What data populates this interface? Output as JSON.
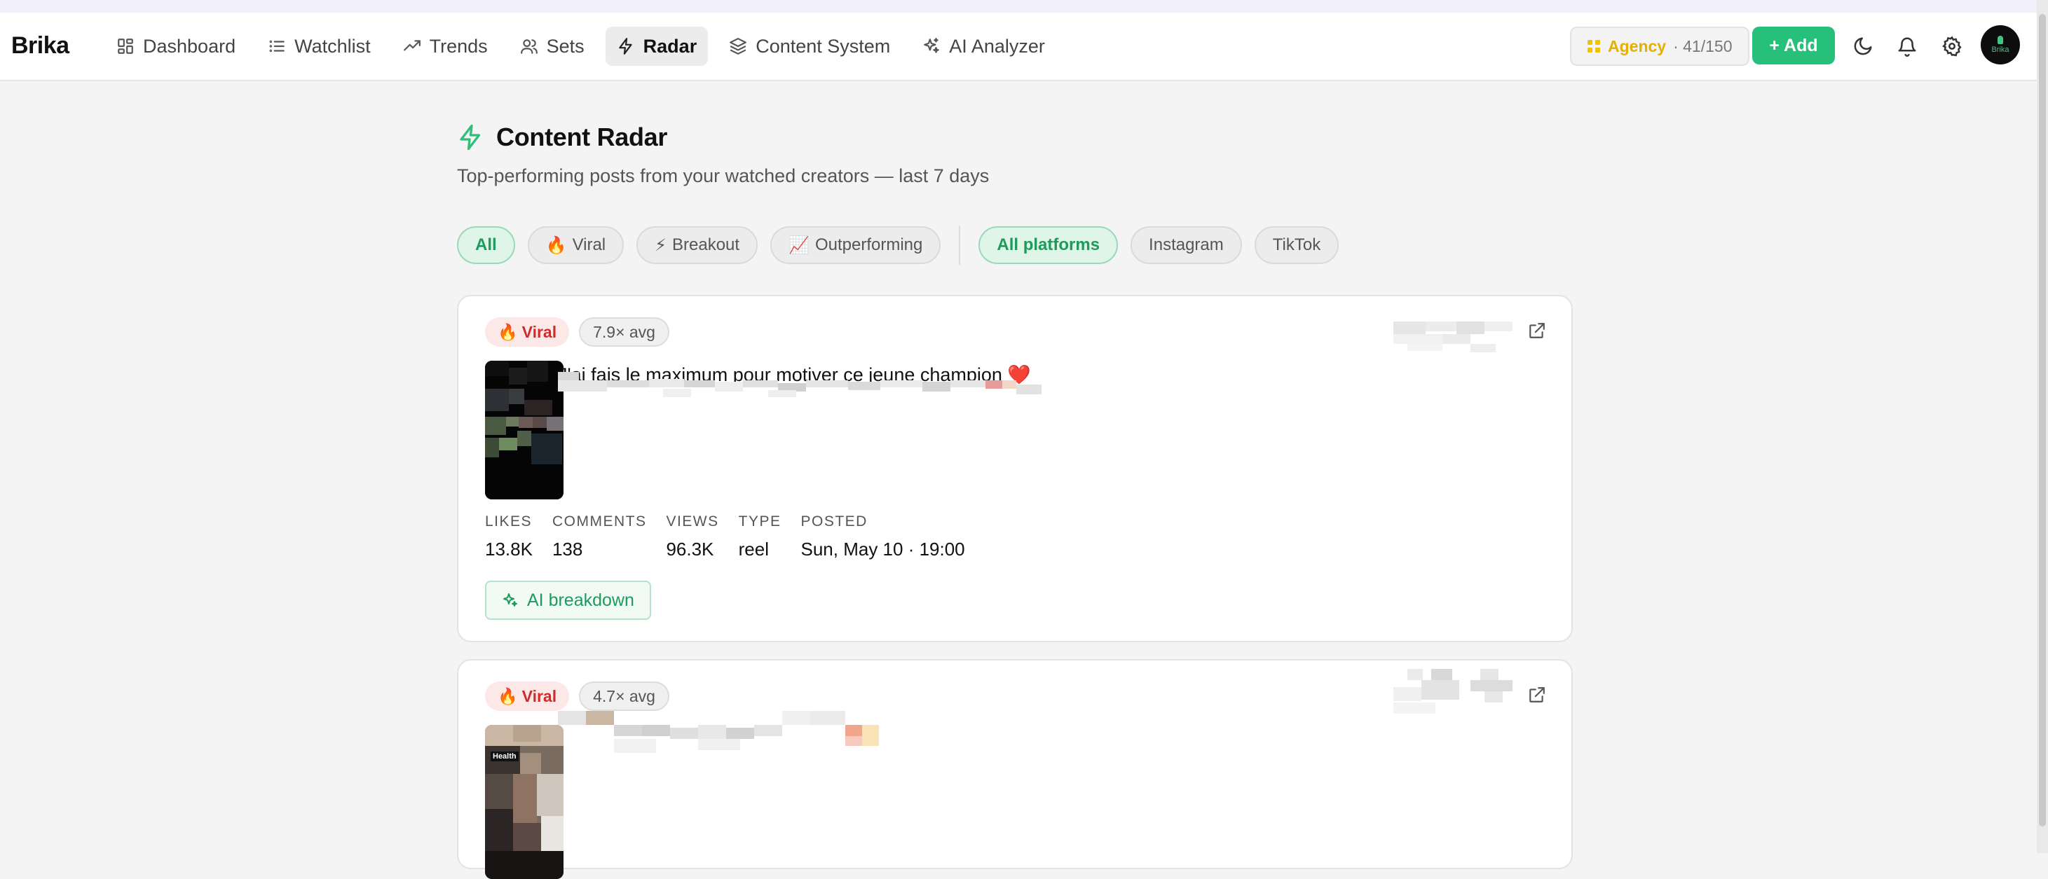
{
  "app": {
    "brand": "Brika",
    "nav": [
      {
        "label": "Dashboard",
        "icon": "dashboard-icon",
        "active": false
      },
      {
        "label": "Watchlist",
        "icon": "list-icon",
        "active": false
      },
      {
        "label": "Trends",
        "icon": "trend-icon",
        "active": false
      },
      {
        "label": "Sets",
        "icon": "users-icon",
        "active": false
      },
      {
        "label": "Radar",
        "icon": "bolt-icon",
        "active": true
      },
      {
        "label": "Content System",
        "icon": "layers-icon",
        "active": false
      },
      {
        "label": "AI Analyzer",
        "icon": "sparkles-icon",
        "active": false
      }
    ],
    "plan": {
      "name": "Agency",
      "usage": "· 41/150"
    },
    "add_label": "+ Add",
    "avatar_text": "Brika"
  },
  "page": {
    "title": "Content Radar",
    "subtitle": "Top-performing posts from your watched creators — last 7 days"
  },
  "filters": {
    "type": [
      {
        "label": "All",
        "emoji": "",
        "active": true
      },
      {
        "label": "Viral",
        "emoji": "🔥",
        "active": false
      },
      {
        "label": "Breakout",
        "emoji": "⚡",
        "active": false
      },
      {
        "label": "Outperforming",
        "emoji": "📈",
        "active": false
      }
    ],
    "platform": [
      {
        "label": "All platforms",
        "active": true
      },
      {
        "label": "Instagram",
        "active": false
      },
      {
        "label": "TikTok",
        "active": false
      }
    ]
  },
  "posts": [
    {
      "badge": "Viral",
      "badge_emoji": "🔥",
      "avg": "7.9× avg",
      "caption": "J'ai fais le maximum pour motiver ce jeune champion ❤️",
      "stats": {
        "likes_label": "LIKES",
        "likes": "13.8K",
        "comments_label": "COMMENTS",
        "comments": "138",
        "views_label": "VIEWS",
        "views": "96.3K",
        "type_label": "TYPE",
        "type": "reel",
        "posted_label": "POSTED",
        "posted": "Sun, May 10 · 19:00"
      },
      "ai_label": "AI breakdown"
    },
    {
      "badge": "Viral",
      "badge_emoji": "🔥",
      "avg": "4.7× avg",
      "thumb_text": "Health"
    }
  ]
}
